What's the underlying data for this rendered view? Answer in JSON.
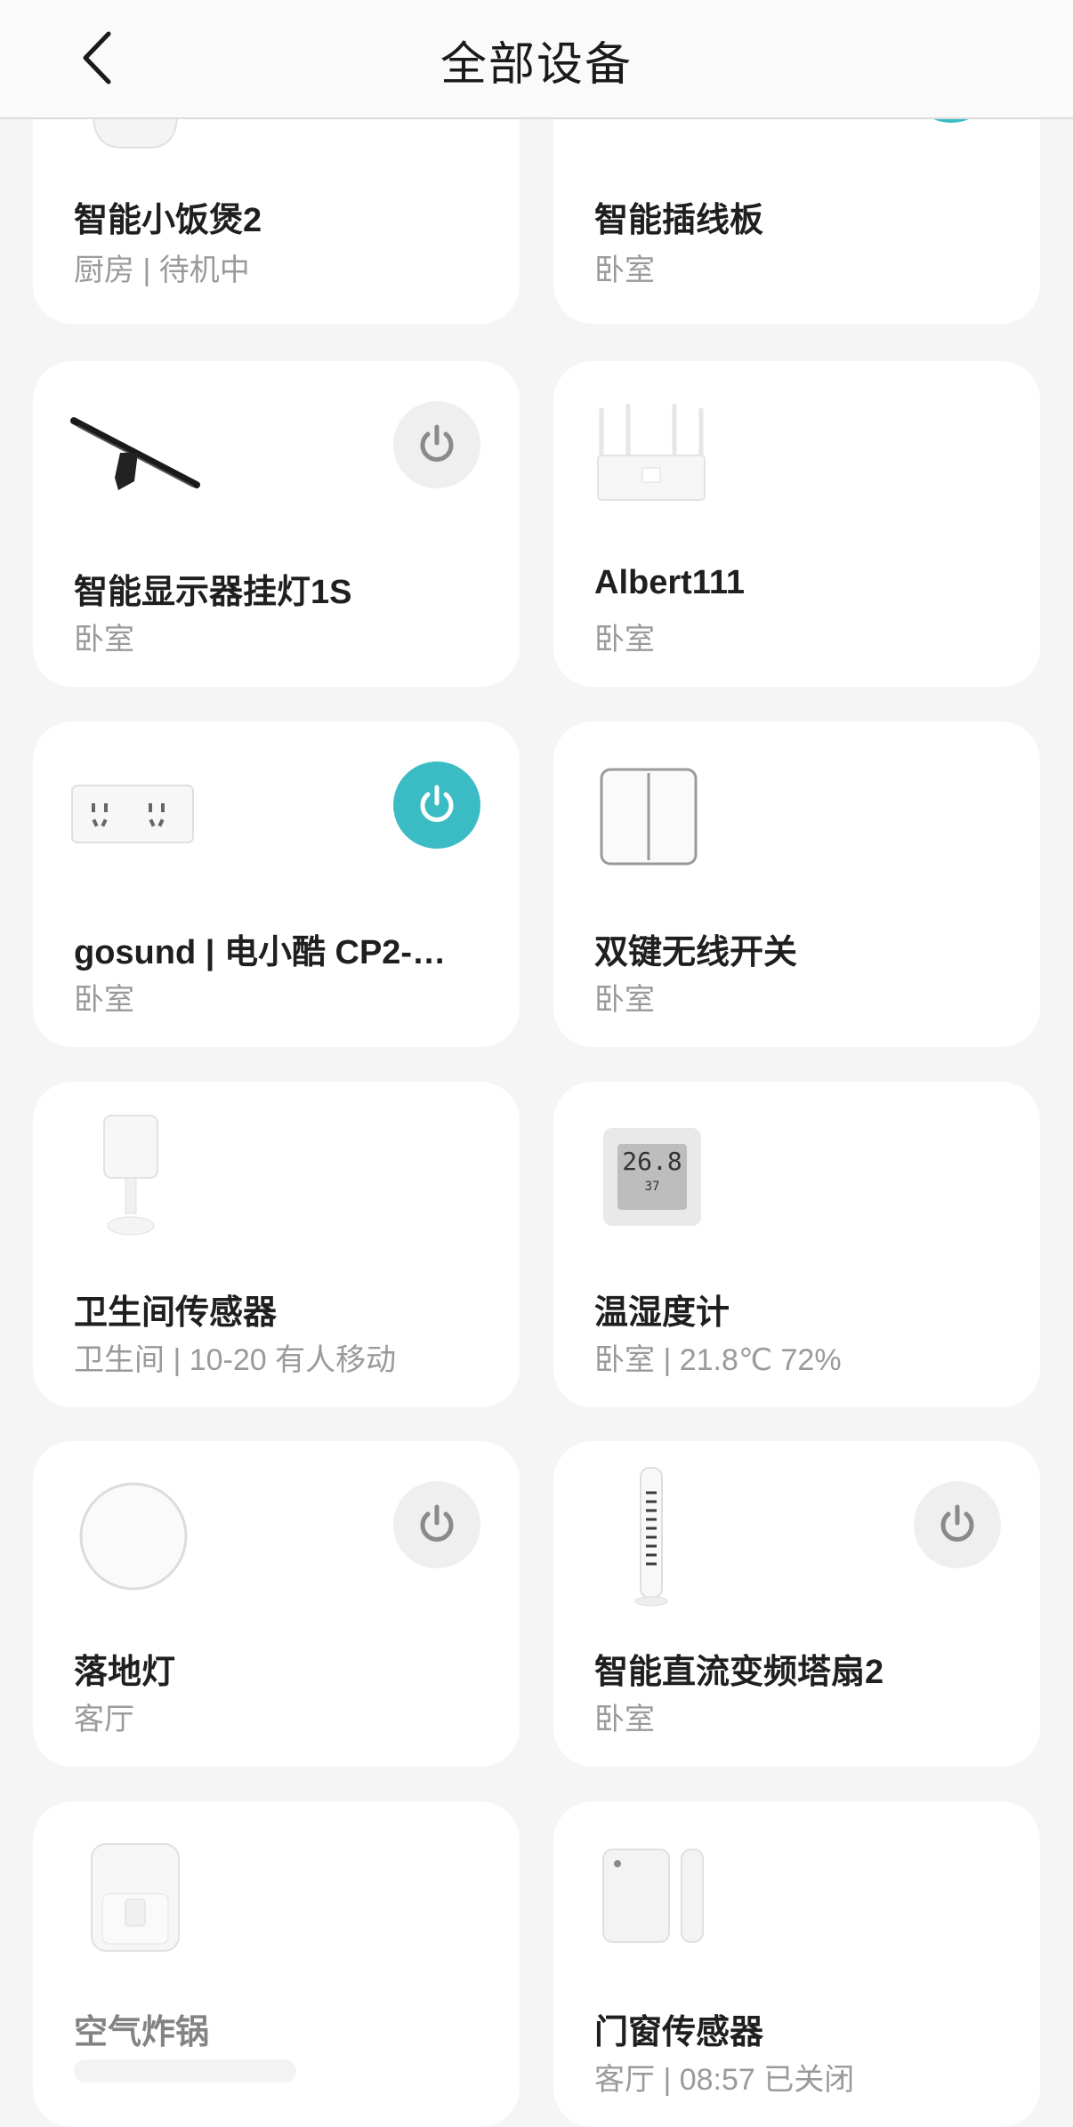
{
  "header": {
    "title": "全部设备"
  },
  "devices": [
    {
      "name": "智能小饭煲2",
      "status": "厨房 | 待机中",
      "icon": "rice-cooker-icon"
    },
    {
      "name": "智能插线板",
      "status": "卧室",
      "icon": "power-strip-icon",
      "power": "on"
    },
    {
      "name": "智能显示器挂灯1S",
      "status": "卧室",
      "icon": "monitor-light-icon",
      "power": "off"
    },
    {
      "name": "Albert111",
      "status": "卧室",
      "icon": "router-icon"
    },
    {
      "name": "gosund | 电小酷 CP2-…",
      "status": "卧室",
      "icon": "socket-icon",
      "power": "on"
    },
    {
      "name": "双键无线开关",
      "status": "卧室",
      "icon": "wall-switch-icon"
    },
    {
      "name": "卫生间传感器",
      "status": "卫生间 | 10-20 有人移动",
      "icon": "motion-sensor-icon"
    },
    {
      "name": "温湿度计",
      "status": "卧室 | 21.8℃ 72%",
      "icon": "thermo-hygrometer-icon",
      "display_temp": "26.8",
      "display_hum": "37"
    },
    {
      "name": "落地灯",
      "status": "客厅",
      "icon": "floor-lamp-icon",
      "power": "off"
    },
    {
      "name": "智能直流变频塔扇2",
      "status": "卧室",
      "icon": "tower-fan-icon",
      "power": "off"
    },
    {
      "name": "空气炸锅",
      "status": "",
      "icon": "air-fryer-icon"
    },
    {
      "name": "门窗传感器",
      "status": "客厅 | 08:57 已关闭",
      "icon": "door-window-sensor-icon"
    }
  ],
  "colors": {
    "accent": "#3bbcc4",
    "card": "#ffffff",
    "background": "#f5f5f5"
  }
}
